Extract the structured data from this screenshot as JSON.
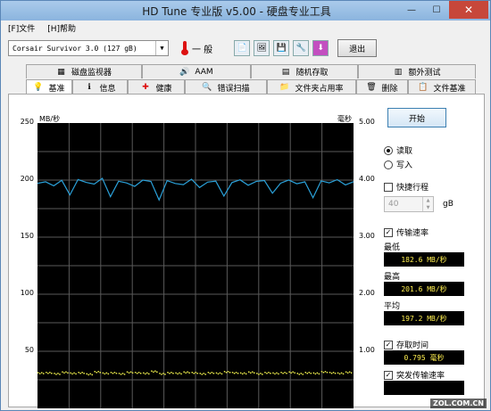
{
  "window": {
    "title": "HD Tune 专业版 v5.00 - 硬盘专业工具",
    "min": "—",
    "max": "☐",
    "close": "✕"
  },
  "menu": [
    {
      "label": "[F]文件"
    },
    {
      "label": "[H]帮助"
    }
  ],
  "toolbar": {
    "drive": "Corsair Survivor 3.0     (127 gB)",
    "temperature": "一 般",
    "exit_label": "退出",
    "icons": [
      "copy-text-icon",
      "copy-screenshot-icon",
      "save-icon",
      "options-icon",
      "download-icon"
    ]
  },
  "tabs_top": [
    {
      "label": "磁盘监视器",
      "icon": "monitor-icon"
    },
    {
      "label": "AAM",
      "icon": "speaker-icon"
    },
    {
      "label": "随机存取",
      "icon": "random-access-icon"
    },
    {
      "label": "额外测试",
      "icon": "extra-tests-icon"
    }
  ],
  "tabs_bottom": [
    {
      "label": "基准",
      "icon": "benchmark-icon"
    },
    {
      "label": "信息",
      "icon": "info-icon"
    },
    {
      "label": "健康",
      "icon": "health-icon"
    },
    {
      "label": "错误扫描",
      "icon": "error-scan-icon"
    },
    {
      "label": "文件夹占用率",
      "icon": "folder-usage-icon"
    },
    {
      "label": "删除",
      "icon": "erase-icon"
    },
    {
      "label": "文件基准",
      "icon": "file-benchmark-icon"
    }
  ],
  "chart": {
    "left_unit": "MB/秒",
    "right_unit": "毫秒",
    "left_ticks": [
      "200",
      "150",
      "100",
      "50"
    ],
    "right_ticks": [
      "5.00",
      "4.00",
      "3.00",
      "2.00",
      "1.00"
    ],
    "colors": {
      "background": "#000000",
      "grid": "#5a5a5a",
      "transfer": "#2aa0d8",
      "access": "#e8e84a"
    }
  },
  "chart_data": {
    "type": "line",
    "xlabel": "",
    "ylabel": "MB/秒",
    "y2label": "毫秒",
    "ylim": [
      0,
      250
    ],
    "y2lim": [
      0,
      6.25
    ],
    "grid": true,
    "series": [
      {
        "values": [
          197.2,
          198.5,
          195.0,
          199.8,
          187.0,
          200.5,
          198.0,
          196.5,
          201.6,
          185.5,
          199.0,
          197.5,
          194.5,
          200.0,
          198.8,
          182.6,
          199.5,
          197.0,
          196.0,
          200.8,
          193.5,
          198.2,
          199.1,
          186.0,
          197.8,
          200.2,
          195.5,
          198.9,
          199.6,
          188.5,
          197.3,
          200.1,
          196.8,
          198.4,
          184.5,
          199.3,
          197.6,
          200.4,
          195.8,
          198.6
        ]
      },
      {
        "values": [
          0.795,
          0.8,
          0.78,
          0.81,
          0.79,
          0.8,
          0.77,
          0.82,
          0.79,
          0.8,
          0.78,
          0.81,
          0.8,
          0.79,
          0.83,
          0.78,
          0.8,
          0.79,
          0.81,
          0.8,
          0.78,
          0.8,
          0.79,
          0.82,
          0.8,
          0.79,
          0.81,
          0.78,
          0.8,
          0.79,
          0.8,
          0.81,
          0.78,
          0.8,
          0.79,
          0.82,
          0.8,
          0.79,
          0.81,
          0.8
        ]
      }
    ]
  },
  "side": {
    "start_label": "开始",
    "read_label": "读取",
    "write_label": "写入",
    "short_stroke_label": "快捷行程",
    "short_stroke_value": "40",
    "short_stroke_unit": "gB",
    "transfer_rate_label": "传输速率",
    "min_label": "最低",
    "min_value": "182.6 MB/秒",
    "max_label": "最高",
    "max_value": "201.6 MB/秒",
    "avg_label": "平均",
    "avg_value": "197.2 MB/秒",
    "access_time_label": "存取时间",
    "access_time_value": "0.795 毫秒",
    "burst_rate_label": "突发传输速率"
  },
  "watermark": "ZOL.COM.CN"
}
